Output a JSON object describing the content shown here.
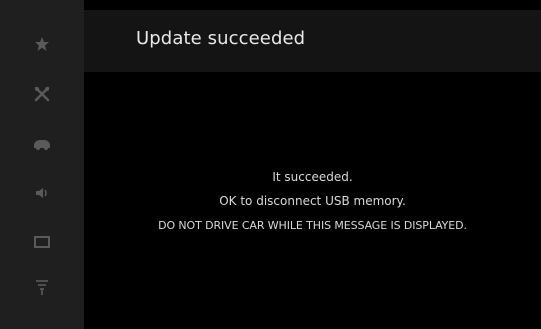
{
  "window": {
    "title": "Update succeeded"
  },
  "sidebar": {
    "items": [
      {
        "icon": "star-icon"
      },
      {
        "icon": "tools-icon"
      },
      {
        "icon": "car-icon"
      },
      {
        "icon": "speaker-icon"
      },
      {
        "icon": "display-icon"
      },
      {
        "icon": "antenna-icon"
      }
    ]
  },
  "message": {
    "line1": "It succeeded.",
    "line2": "OK to disconnect USB memory.",
    "line3": "DO NOT DRIVE CAR WHILE THIS MESSAGE IS DISPLAYED."
  },
  "colors": {
    "background": "#000000",
    "sidebar": "#1f1f1f",
    "header": "#141414",
    "icon": "#5a5a5a",
    "text": "#d9d9d9"
  }
}
